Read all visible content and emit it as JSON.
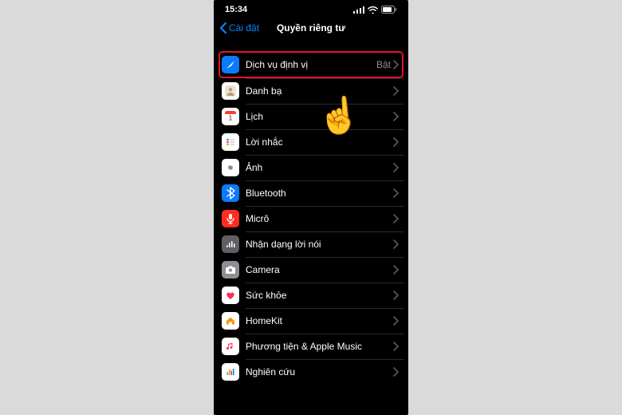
{
  "status": {
    "time": "15:34"
  },
  "nav": {
    "back": "Cài đặt",
    "title": "Quyền riêng tư"
  },
  "rows": [
    {
      "key": "location",
      "label": "Dịch vụ định vị",
      "value": "Bật",
      "highlight": true
    },
    {
      "key": "contacts",
      "label": "Danh bạ"
    },
    {
      "key": "calendar",
      "label": "Lịch"
    },
    {
      "key": "reminders",
      "label": "Lời nhắc"
    },
    {
      "key": "photos",
      "label": "Ảnh"
    },
    {
      "key": "bluetooth",
      "label": "Bluetooth"
    },
    {
      "key": "microphone",
      "label": "Micrô"
    },
    {
      "key": "speech",
      "label": "Nhận dạng lời nói"
    },
    {
      "key": "camera",
      "label": "Camera"
    },
    {
      "key": "health",
      "label": "Sức khỏe"
    },
    {
      "key": "homekit",
      "label": "HomeKit"
    },
    {
      "key": "media",
      "label": "Phương tiện & Apple Music"
    },
    {
      "key": "research",
      "label": "Nghiên cứu"
    }
  ],
  "icons": {
    "location": {
      "bg": "#0a7bff"
    },
    "contacts": {
      "bg": "#ffffff"
    },
    "calendar": {
      "bg": "#ffffff"
    },
    "reminders": {
      "bg": "#ffffff"
    },
    "photos": {
      "bg": "#ffffff"
    },
    "bluetooth": {
      "bg": "#0a7bff"
    },
    "microphone": {
      "bg": "#ff2d1f"
    },
    "speech": {
      "bg": "#5f5f64"
    },
    "camera": {
      "bg": "#8e8e93"
    },
    "health": {
      "bg": "#ffffff"
    },
    "homekit": {
      "bg": "#ffffff"
    },
    "media": {
      "bg": "#ffffff"
    },
    "research": {
      "bg": "#ffffff"
    }
  }
}
